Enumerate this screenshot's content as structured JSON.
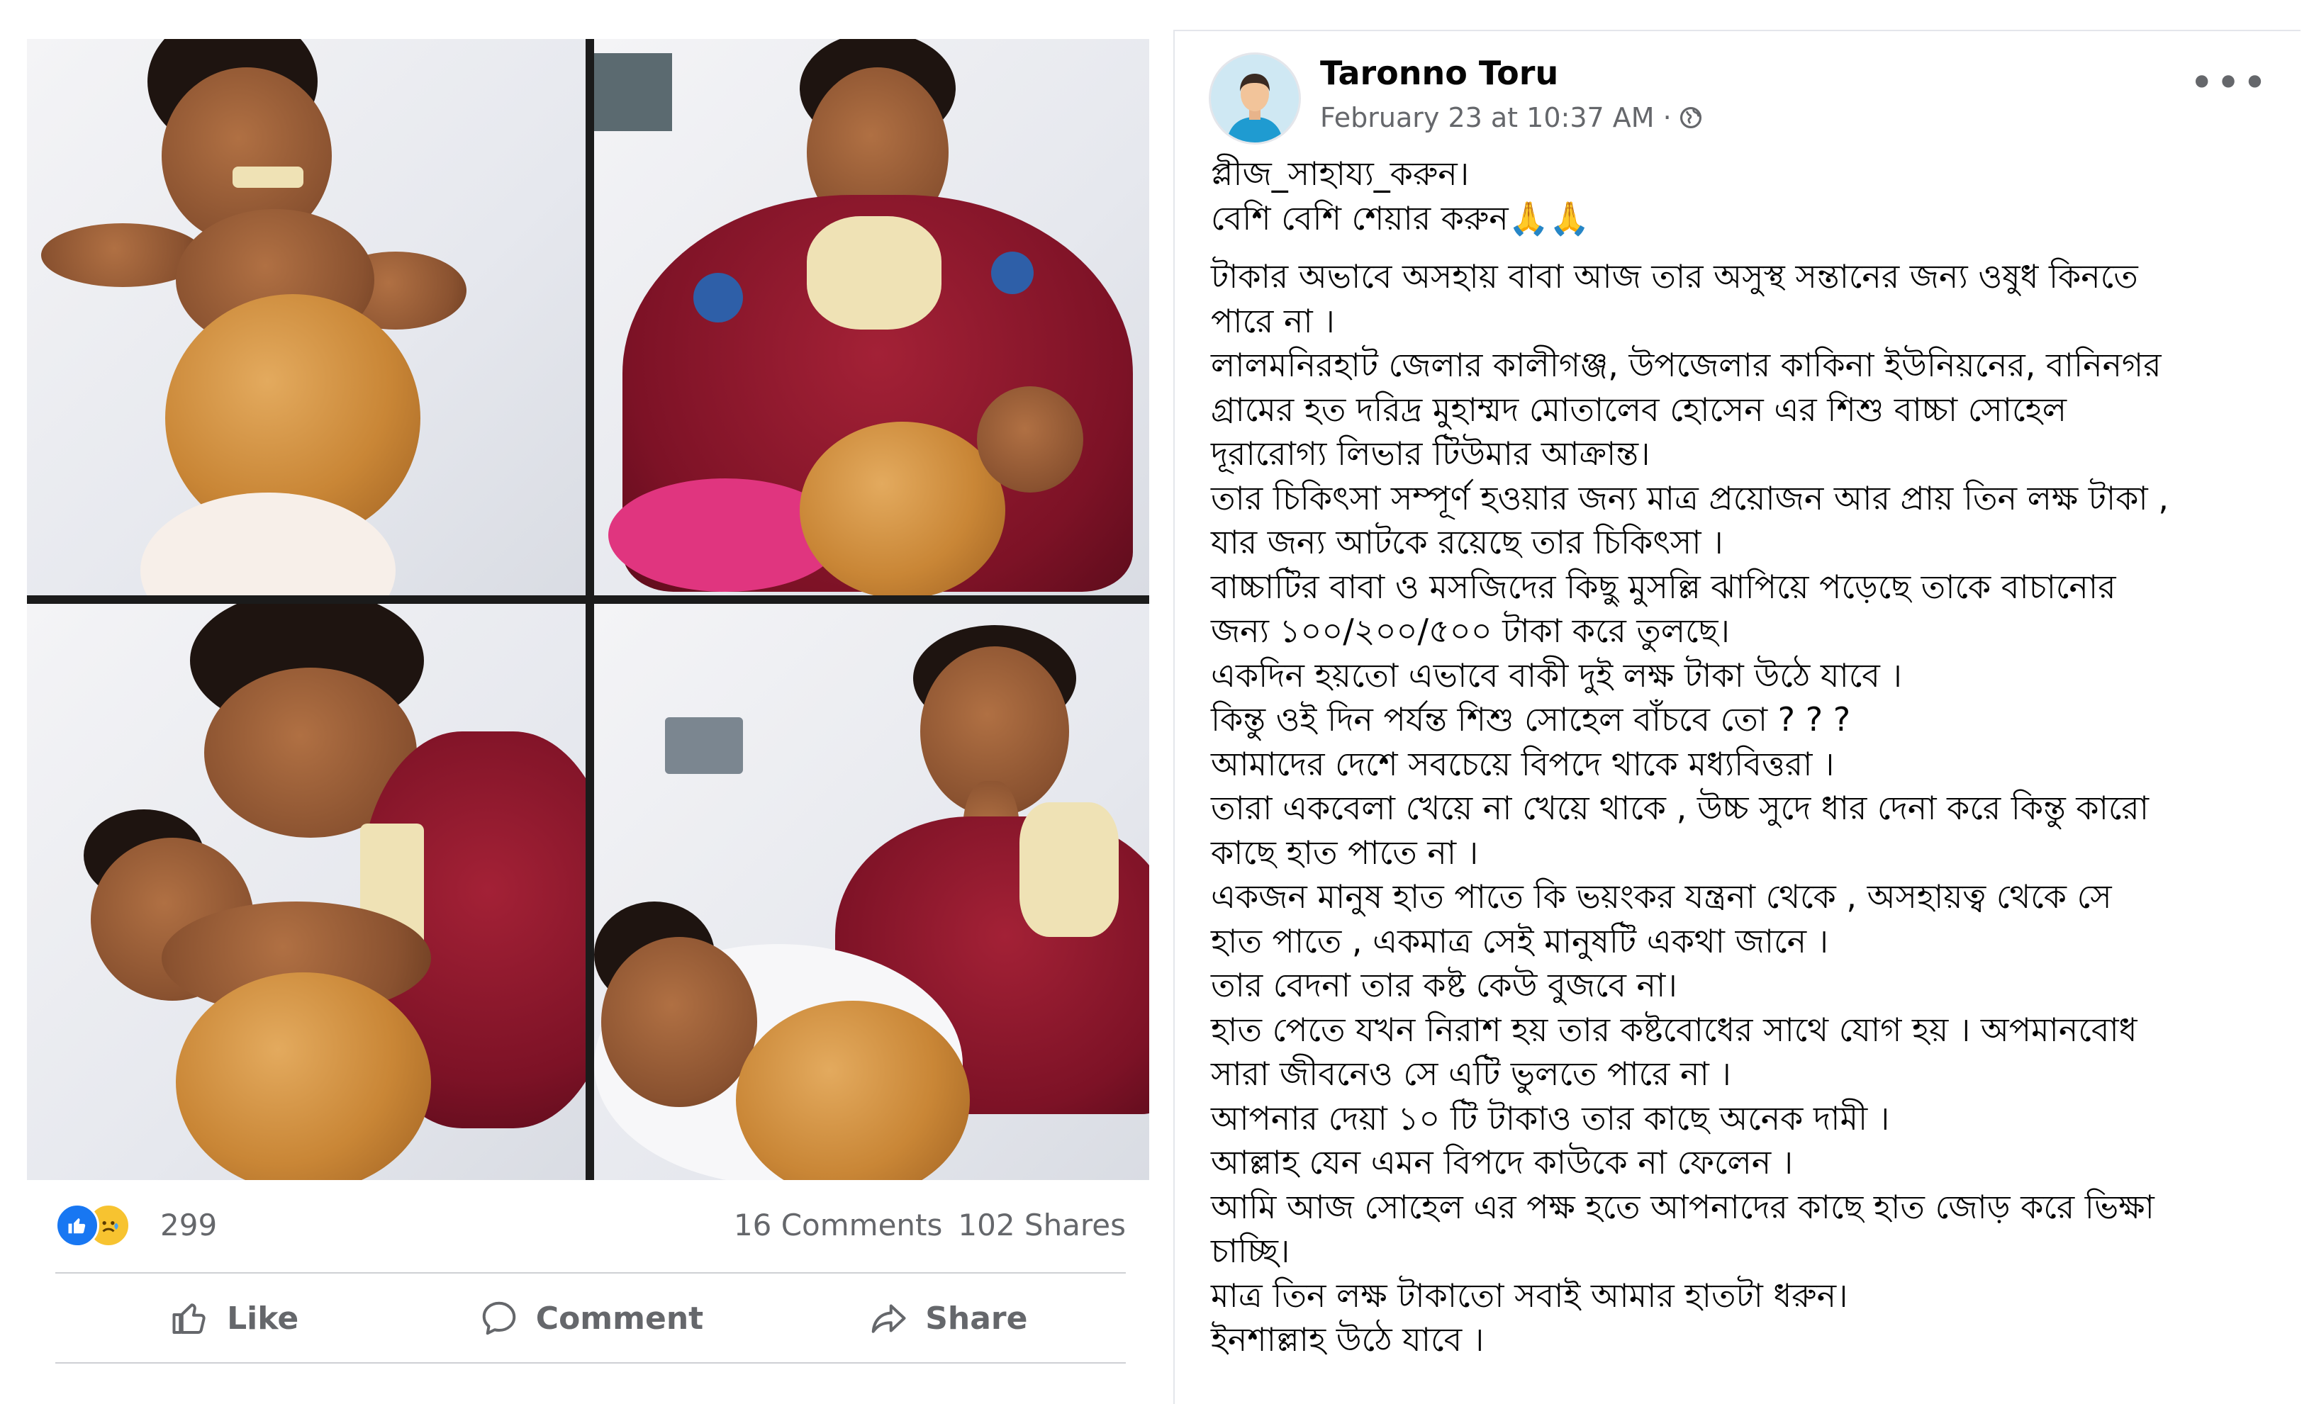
{
  "post": {
    "author": "Taronno Toru",
    "timestamp": "February 23 at 10:37 AM · ",
    "privacy_icon": "globe-icon",
    "intro_lines": [
      "প্লীজ_সাহায্য_করুন।",
      "বেশি বেশি শেয়ার করুন🙏🙏"
    ],
    "body_lines": [
      "টাকার অভাবে  অসহায় বাবা আজ তার অসুস্থ সন্তানের জন্য ওষুধ কিনতে",
      "পারে না ।",
      "লালমনিরহাট জেলার কালীগঞ্জ, উপজেলার কাকিনা ইউনিয়নের, বানিনগর",
      "গ্রামের হত দরিদ্র  মুহাম্মদ মোতালেব হোসেন এর শিশু বাচ্চা  সোহেল",
      "দূরারোগ্য লিভার টিউমার আক্রান্ত।",
      "তার চিকিৎসা সম্পূর্ণ হওয়ার জন্য মাত্র প্রয়োজন আর প্রায় তিন লক্ষ টাকা ,",
      "যার জন্য আটকে রয়েছে তার চিকিৎসা ।",
      "বাচ্চাটির বাবা ও মসজিদের কিছু মুসল্লি ঝাপিয়ে পড়েছে তাকে বাচানোর",
      "জন্য ১০০/২০০/৫০০ টাকা করে তুলছে।",
      "একদিন হয়তো এভাবে বাকী দুই লক্ষ টাকা উঠে যাবে ।",
      "কিন্তু ওই দিন পর্যন্ত শিশু সোহেল  বাঁচবে তো ? ? ?",
      "আমাদের দেশে সবচেয়ে বিপদে থাকে মধ্যবিত্তরা ।",
      "তারা একবেলা খেয়ে না খেয়ে থাকে , উচ্চ সুদে ধার দেনা করে কিন্তু কারো",
      "কাছে হাত পাতে না ।",
      "একজন মানুষ হাত পাতে কি ভয়ংকর যন্ত্রনা থেকে , অসহায়ত্ব থেকে সে",
      "হাত পাতে , একমাত্র সেই মানুষটি একথা জানে ।",
      "তার বেদনা তার কষ্ট কেউ বুজবে না।",
      "হাত পেতে যখন নিরাশ হয় তার কষ্টবোধের সাথে যোগ হয় । অপমানবোধ",
      "সারা জীবনেও সে এটি ভুলতে পারে না ।",
      "আপনার দেয়া ১০ টি টাকাও তার কাছে অনেক দামী ।",
      "আল্লাহ যেন এমন বিপদে কাউকে না ফেলেন ।",
      "আমি আজ সোহেল এর পক্ষ হতে আপনাদের কাছে হাত জোড় করে ভিক্ষা",
      "চাচ্ছি।",
      "মাত্র তিন লক্ষ টাকাতো সবাই আমার হাতটা ধরুন।",
      "ইনশাল্লাহ উঠে যাবে ।"
    ],
    "more_label": "•••"
  },
  "reactions": {
    "icons": [
      "like-reaction-icon",
      "sad-reaction-icon"
    ],
    "count": "299",
    "comments": "16 Comments",
    "shares": "102 Shares"
  },
  "actions": {
    "like": "Like",
    "comment": "Comment",
    "share": "Share"
  },
  "colors": {
    "facebook_blue": "#1877f2",
    "secondary_text": "#65676b",
    "primary_text": "#050505",
    "divider": "#ced0d4"
  }
}
